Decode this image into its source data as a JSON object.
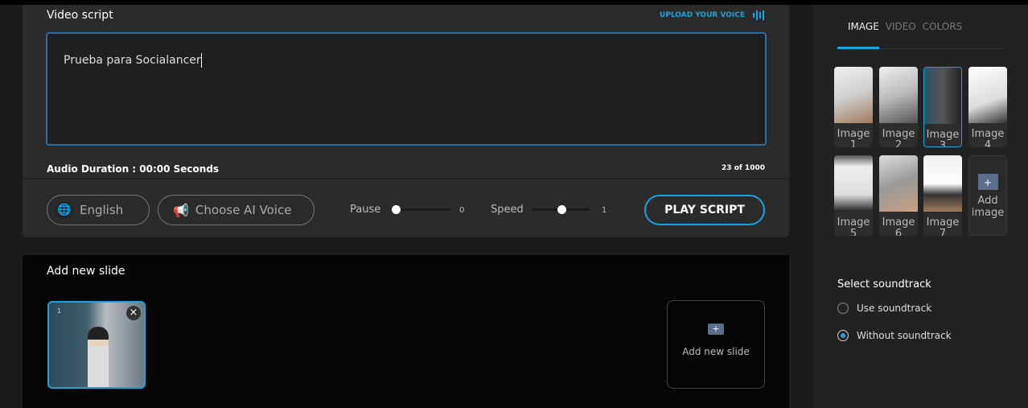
{
  "script": {
    "title": "Video script",
    "upload_label": "UPLOAD YOUR VOICE",
    "text": "Prueba para Socialancer",
    "duration": "Audio Duration : 00:00 Seconds",
    "count": "23 of 1000"
  },
  "controls": {
    "language": "English",
    "voice": "Choose AI Voice",
    "pause_label": "Pause",
    "pause_value": "0",
    "speed_label": "Speed",
    "speed_value": "1",
    "play": "PLAY SCRIPT"
  },
  "slides": {
    "title": "Add new slide",
    "items": [
      {
        "number": "1"
      }
    ],
    "add_label": "Add new slide"
  },
  "side": {
    "tabs": [
      "IMAGE",
      "VIDEO",
      "COLORS"
    ],
    "active_tab": "IMAGE",
    "images": [
      "Image 1",
      "Image 2",
      "Image 3",
      "Image 4",
      "Image 5",
      "Image 6",
      "Image 7"
    ],
    "selected_image": "Image 3",
    "add_image": "Add image",
    "soundtrack_title": "Select soundtrack",
    "soundtrack_options": [
      "Use soundtrack",
      "Without soundtrack"
    ],
    "soundtrack_selected": "Without soundtrack"
  },
  "colors": {
    "accent": "#1aa3dc"
  }
}
